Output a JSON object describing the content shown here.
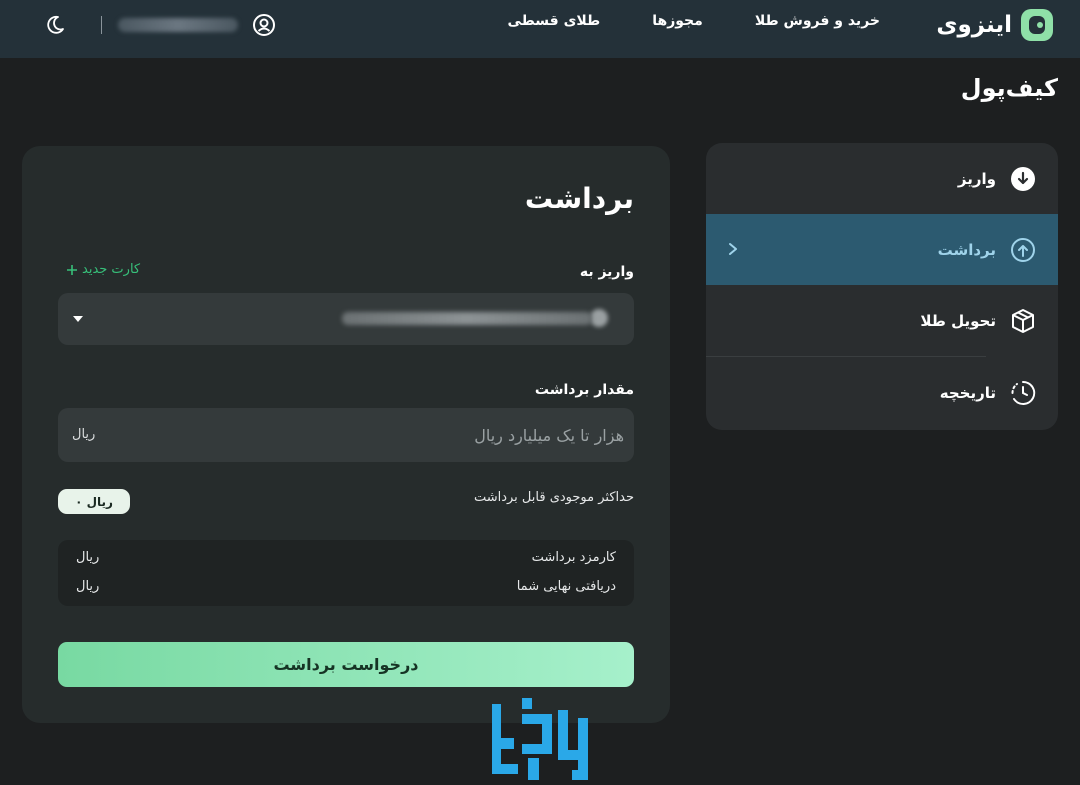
{
  "header": {
    "brand": "اینزوی",
    "nav": [
      "خرید و فروش طلا",
      "مجوزها",
      "طلای قسطی"
    ],
    "theme_icon": "moon-icon",
    "user_icon": "user-circle-icon"
  },
  "page": {
    "title": "کیف‌پول"
  },
  "sidebar": {
    "items": [
      {
        "label": "واریز",
        "icon": "download-circle-icon"
      },
      {
        "label": "برداشت",
        "icon": "upload-circle-icon",
        "active": true
      },
      {
        "label": "تحویل طلا",
        "icon": "box-icon"
      },
      {
        "label": "تاریخچه",
        "icon": "history-icon"
      }
    ]
  },
  "withdraw": {
    "title": "برداشت",
    "destination_label": "واریز به",
    "new_card": "کارت جدید",
    "amount_label": "مقدار برداشت",
    "amount_placeholder": "هزار تا یک میلیارد ریال",
    "amount_unit": "ریال",
    "max_label": "حداکثر موجودی قابل برداشت",
    "max_value": "۰ ریال",
    "fee_label": "کارمزد برداشت",
    "fee_value": "ریال",
    "final_label": "دریافتی نهایی شما",
    "final_value": "ریال",
    "submit": "درخواست برداشت"
  },
  "colors": {
    "background": "#1d1f20",
    "topbar": "#243139",
    "card": "#262c2c",
    "active_item": "#2c5a70",
    "accent_green": "#37c07a",
    "button_start": "#78d9a2",
    "button_end": "#a6f0cb"
  }
}
